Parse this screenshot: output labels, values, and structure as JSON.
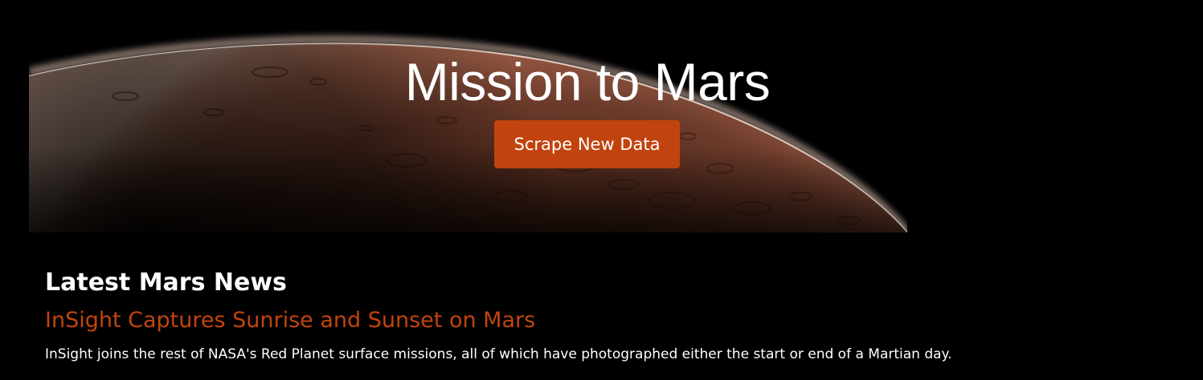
{
  "hero": {
    "title": "Mission to Mars",
    "scrape_button_label": "Scrape New Data",
    "image": "mars-horizon-image"
  },
  "news": {
    "section_heading": "Latest Mars News",
    "title": "InSight Captures Sunrise and Sunset on Mars",
    "teaser": "InSight joins the rest of NASA's Red Planet surface missions, all of which have photographed either the start or end of a Martian day."
  },
  "colors": {
    "background": "#000000",
    "accent": "#c1440e",
    "text": "#ffffff"
  }
}
